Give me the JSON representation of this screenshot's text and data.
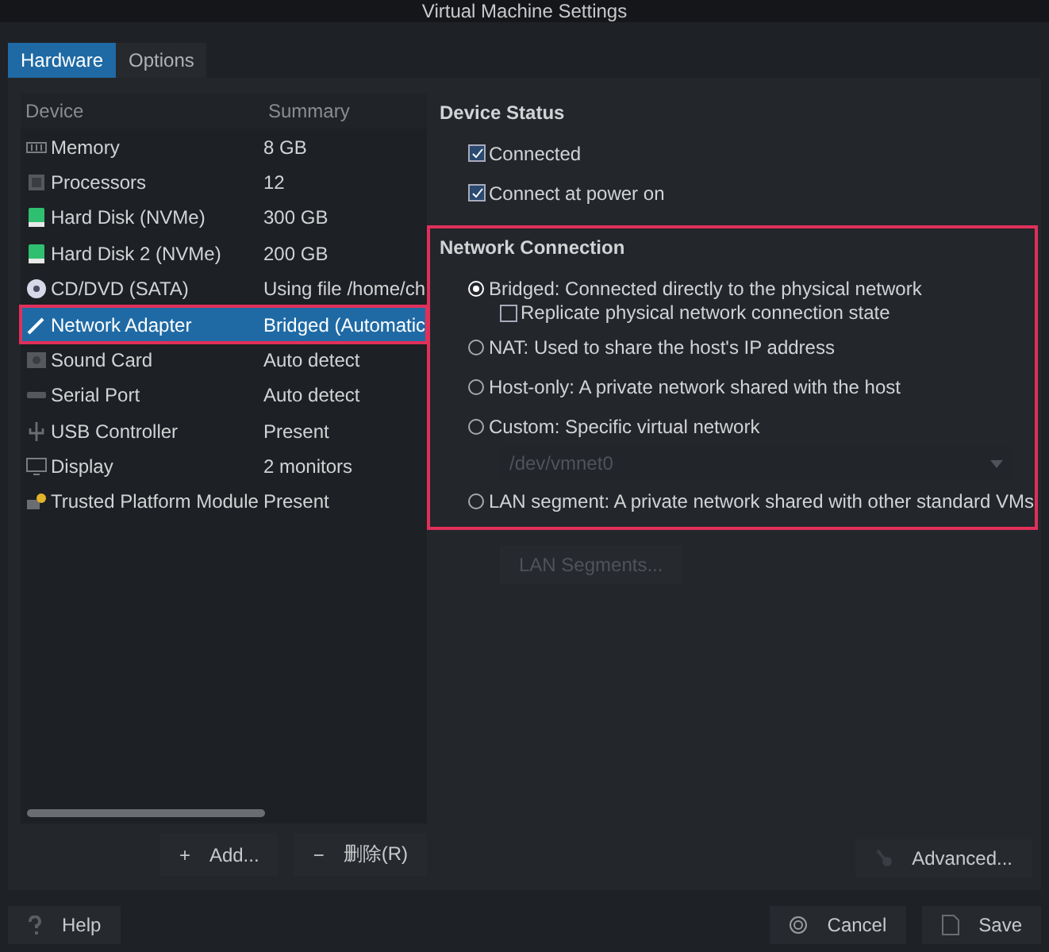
{
  "window": {
    "title": "Virtual Machine Settings"
  },
  "tabs": [
    {
      "label": "Hardware",
      "selected": true
    },
    {
      "label": "Options",
      "selected": false
    }
  ],
  "device_list": {
    "columns": [
      "Device",
      "Summary"
    ],
    "rows": [
      {
        "kind": "memory",
        "device": "Memory",
        "summary": "8 GB",
        "selected": false
      },
      {
        "kind": "cpu",
        "device": "Processors",
        "summary": "12",
        "selected": false
      },
      {
        "kind": "disk",
        "device": "Hard Disk (NVMe)",
        "summary": "300 GB",
        "selected": false
      },
      {
        "kind": "disk",
        "device": "Hard Disk 2 (NVMe)",
        "summary": "200 GB",
        "selected": false
      },
      {
        "kind": "cdrom",
        "device": "CD/DVD (SATA)",
        "summary": "Using file /home/ch",
        "selected": false
      },
      {
        "kind": "network",
        "device": "Network Adapter",
        "summary": "Bridged (Automatic",
        "selected": true
      },
      {
        "kind": "sound",
        "device": "Sound Card",
        "summary": "Auto detect",
        "selected": false
      },
      {
        "kind": "serial",
        "device": "Serial Port",
        "summary": "Auto detect",
        "selected": false
      },
      {
        "kind": "usb",
        "device": "USB Controller",
        "summary": "Present",
        "selected": false
      },
      {
        "kind": "display",
        "device": "Display",
        "summary": "2 monitors",
        "selected": false
      },
      {
        "kind": "tpm",
        "device": "Trusted Platform Module",
        "summary": "Present",
        "selected": false
      }
    ],
    "buttons": [
      {
        "label": "Add...",
        "icon": "+"
      },
      {
        "label": "删除(R)",
        "icon": "−"
      }
    ]
  },
  "device_status": {
    "title": "Device Status",
    "options": [
      {
        "label": "Connected",
        "checked": true
      },
      {
        "label": "Connect at power on",
        "checked": true
      }
    ]
  },
  "network_connection": {
    "title": "Network Connection",
    "options": [
      {
        "label": "Bridged: Connected directly to the physical network",
        "selected": true,
        "sub": {
          "label": "Replicate physical network connection state",
          "checked": false
        }
      },
      {
        "label": "NAT: Used to share the host's IP address",
        "selected": false
      },
      {
        "label": "Host-only: A private network shared with the host",
        "selected": false
      },
      {
        "label": "Custom: Specific virtual network",
        "selected": false,
        "dropdown": {
          "value": "/dev/vmnet0",
          "disabled": true
        }
      },
      {
        "label": "LAN segment: A private network shared with other standard VMs",
        "selected": false
      }
    ],
    "lan_segments_button": {
      "label": "LAN Segments...",
      "disabled": true
    }
  },
  "advanced_button": {
    "label": "Advanced..."
  },
  "footer": {
    "help": "Help",
    "cancel": "Cancel",
    "save": "Save"
  }
}
